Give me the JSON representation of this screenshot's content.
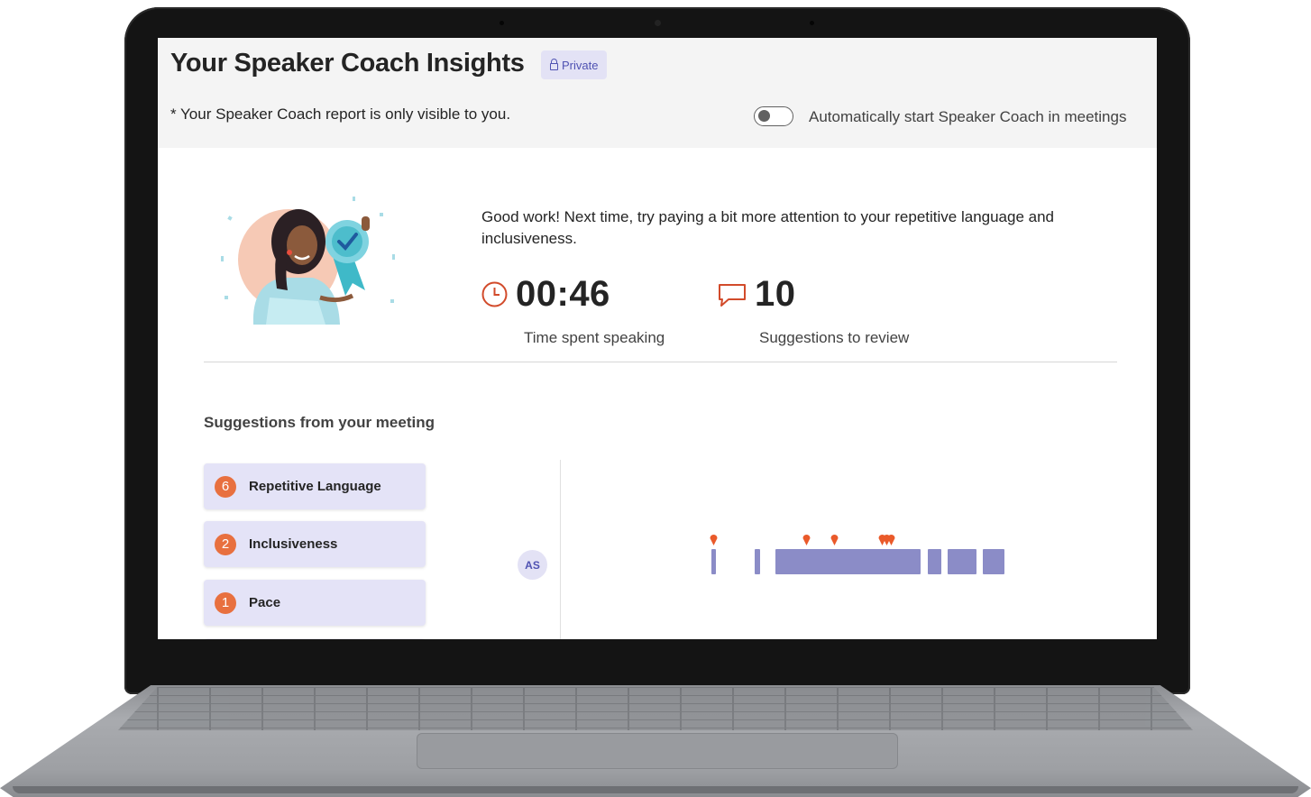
{
  "header": {
    "title": "Your Speaker Coach Insights",
    "private_label": "Private",
    "visibility_note": "* Your Speaker Coach report is only visible to you.",
    "auto_start_label": "Automatically start Speaker Coach in meetings",
    "auto_start_enabled": false
  },
  "summary": {
    "message": "Good work! Next time, try paying a bit more attention to your repetitive language and inclusiveness.",
    "time_value": "00:46",
    "time_label": "Time spent speaking",
    "suggestions_value": "10",
    "suggestions_label": "Suggestions to review"
  },
  "suggestions": {
    "title": "Suggestions from your meeting",
    "items": [
      {
        "count": "6",
        "label": "Repetitive Language"
      },
      {
        "count": "2",
        "label": "Inclusiveness"
      },
      {
        "count": "1",
        "label": "Pace"
      }
    ]
  },
  "timeline": {
    "speaker_initials": "AS"
  },
  "colors": {
    "accent": "#4f52b2",
    "badge": "#e8703f",
    "card": "#e4e3f7",
    "timeline_segment": "#8b8cc7"
  },
  "icons": {
    "clock": "clock-icon",
    "chat": "chat-bubble-icon",
    "lock": "lock-icon"
  }
}
